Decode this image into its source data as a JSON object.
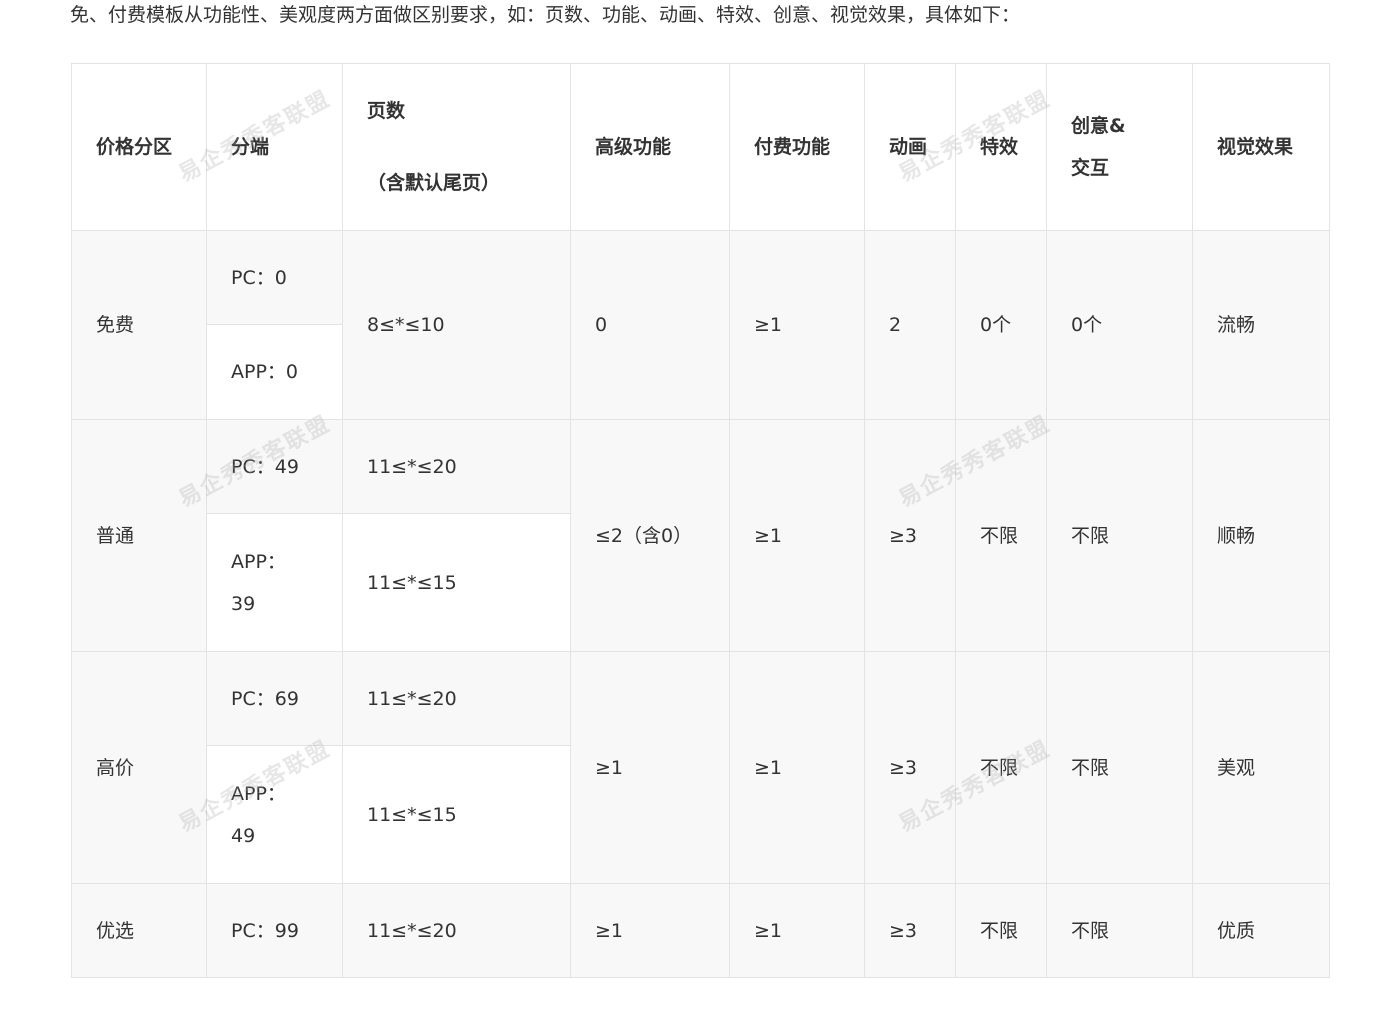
{
  "intro": "免、付费模板从功能性、美观度两方面做区别要求，如：页数、功能、动画、特效、创意、视觉效果，具体如下：",
  "headers": {
    "price_zone": "价格分区",
    "platform": "分端",
    "pages_line1": "页数",
    "pages_line2": "（含默认尾页）",
    "advanced": "高级功能",
    "paid": "付费功能",
    "animation": "动画",
    "effects": "特效",
    "creative_line1": "创意&",
    "creative_line2": "交互",
    "visual": "视觉效果"
  },
  "rows": {
    "free": {
      "zone": "免费",
      "pc": "PC：0",
      "app": "APP：0",
      "pages": "8≤*≤10",
      "advanced": "0",
      "paid": "≥1",
      "animation": "2",
      "effects": "0个",
      "creative": "0个",
      "visual": "流畅"
    },
    "normal": {
      "zone": "普通",
      "pc": "PC：49",
      "app_line1": "APP：",
      "app_line2": "39",
      "pc_pages": "11≤*≤20",
      "app_pages": "11≤*≤15",
      "advanced": "≤2（含0）",
      "paid": "≥1",
      "animation": "≥3",
      "effects": "不限",
      "creative": "不限",
      "visual": "顺畅"
    },
    "premium": {
      "zone": "高价",
      "pc": "PC：69",
      "app_line1": "APP：",
      "app_line2": "49",
      "pc_pages": "11≤*≤20",
      "app_pages": "11≤*≤15",
      "advanced": "≥1",
      "paid": "≥1",
      "animation": "≥3",
      "effects": "不限",
      "creative": "不限",
      "visual": "美观"
    },
    "select": {
      "zone": "优选",
      "pc": "PC：99",
      "pages": "11≤*≤20",
      "advanced": "≥1",
      "paid": "≥1",
      "animation": "≥3",
      "effects": "不限",
      "creative": "不限",
      "visual": "优质"
    }
  },
  "watermark": "易企秀秀客联盟"
}
